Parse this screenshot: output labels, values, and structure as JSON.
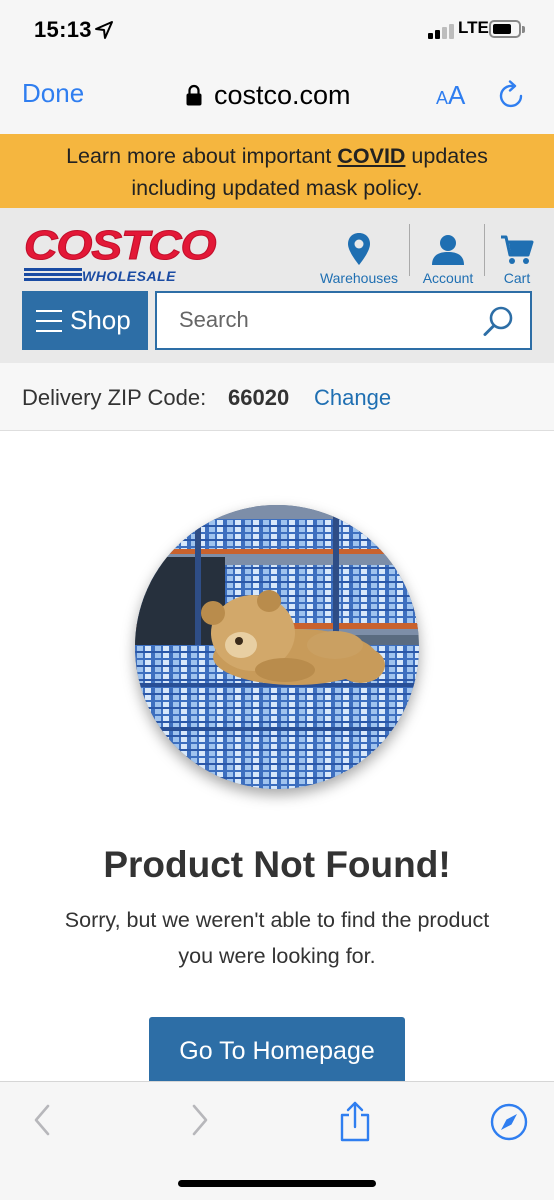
{
  "status_bar": {
    "time": "15:13",
    "network": "LTE"
  },
  "browser": {
    "done_label": "Done",
    "url": "costco.com",
    "text_size_small": "A",
    "text_size_large": "A"
  },
  "banner": {
    "prefix": "Learn more about important ",
    "link": "COVID",
    "suffix_line1": " updates",
    "line2": "including updated mask policy."
  },
  "header": {
    "logo_main": "COSTCO",
    "logo_sub": "WHOLESALE",
    "warehouses_label": "Warehouses",
    "account_label": "Account",
    "cart_label": "Cart",
    "shop_label": "Shop",
    "search_placeholder": "Search"
  },
  "delivery": {
    "label": "Delivery ZIP Code:",
    "zip": "66020",
    "change_label": "Change"
  },
  "content": {
    "title": "Product Not Found!",
    "message": "Sorry, but we weren't able to find the product you were looking for.",
    "button_label": "Go To Homepage"
  },
  "colors": {
    "accent_blue": "#2d6ea6",
    "link_blue": "#1f6fb2",
    "banner_yellow": "#f5b63f",
    "costco_red": "#e31837",
    "ios_blue": "#2f7ef0"
  }
}
